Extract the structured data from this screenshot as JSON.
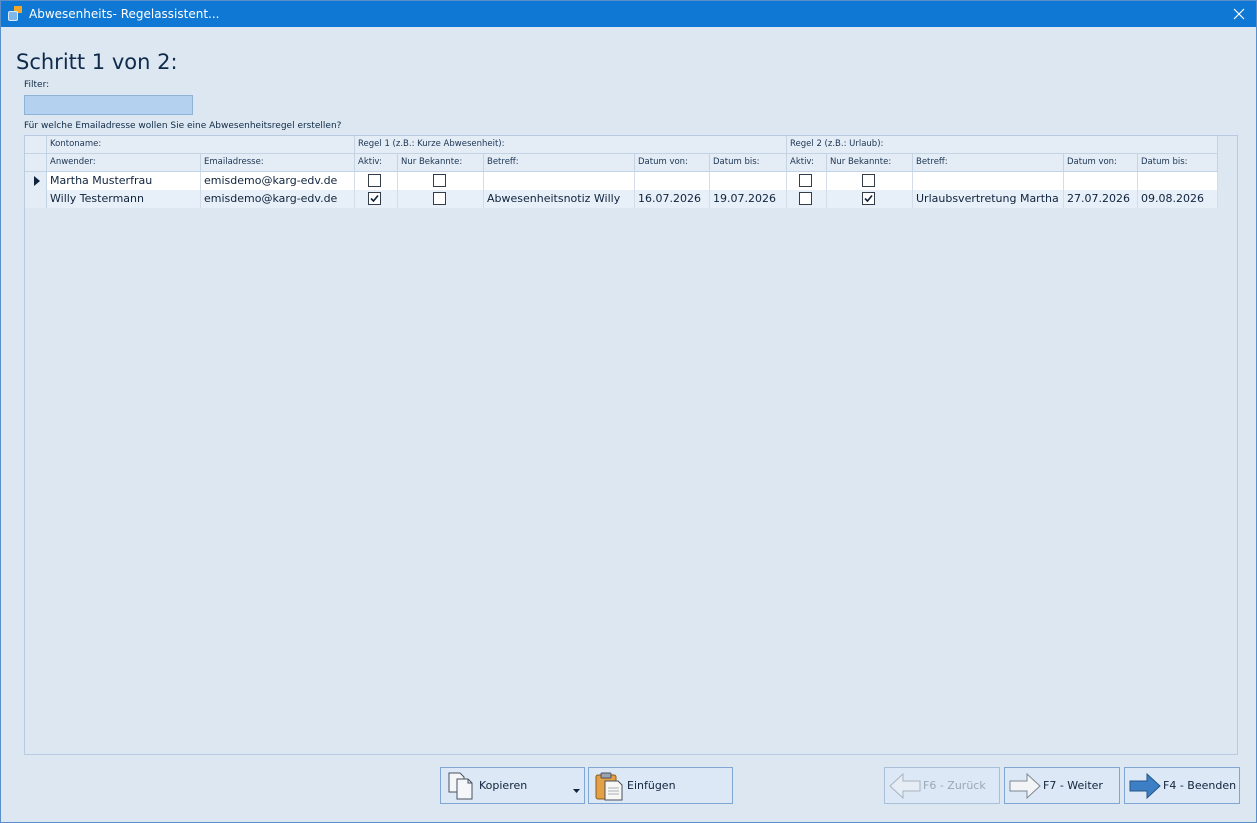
{
  "window": {
    "title": "Abwesenheits- Regelassistent..."
  },
  "step_title": "Schritt 1 von 2:",
  "filter": {
    "label": "Filter:",
    "value": ""
  },
  "question": "Für welche Emailadresse wollen Sie eine Abwesenheitsregel erstellen?",
  "grid": {
    "group_headers": {
      "konto": "Kontoname:",
      "rule1": "Regel 1 (z.B.: Kurze Abwesenheit):",
      "rule2": "Regel 2 (z.B.: Urlaub):"
    },
    "columns": {
      "anwender": "Anwender:",
      "email": "Emailadresse:",
      "r1_aktiv": "Aktiv:",
      "r1_bekannte": "Nur Bekannte:",
      "r1_betreff": "Betreff:",
      "r1_von": "Datum von:",
      "r1_bis": "Datum bis:",
      "r2_aktiv": "Aktiv:",
      "r2_bekannte": "Nur Bekannte:",
      "r2_betreff": "Betreff:",
      "r2_von": "Datum von:",
      "r2_bis": "Datum bis:"
    },
    "rows": [
      {
        "current": true,
        "anwender": "Martha Musterfrau",
        "email": "emisdemo@karg-edv.de",
        "r1_aktiv": false,
        "r1_bekannte": false,
        "r1_betreff": "",
        "r1_von": "",
        "r1_bis": "",
        "r2_aktiv": false,
        "r2_bekannte": false,
        "r2_betreff": "",
        "r2_von": "",
        "r2_bis": ""
      },
      {
        "current": false,
        "anwender": "Willy Testermann",
        "email": "emisdemo@karg-edv.de",
        "r1_aktiv": true,
        "r1_bekannte": false,
        "r1_betreff": "Abwesenheitsnotiz Willy",
        "r1_von": "16.07.2026",
        "r1_bis": "19.07.2026",
        "r2_aktiv": false,
        "r2_bekannte": true,
        "r2_betreff": "Urlaubsvertretung Martha",
        "r2_von": "27.07.2026",
        "r2_bis": "09.08.2026"
      }
    ]
  },
  "buttons": {
    "kopieren": "Kopieren",
    "einfuegen": "Einfügen",
    "zurueck": "F6 - Zurück",
    "weiter": "F7 - Weiter",
    "beenden": "F4 - Beenden"
  },
  "icons": {
    "app": "app-icon",
    "close": "close-icon",
    "copy": "copy-icon",
    "paste": "clipboard-icon",
    "back": "arrow-left-icon",
    "next": "arrow-right-icon",
    "finish": "arrow-right-blue-icon",
    "dropdown": "caret-down-icon"
  },
  "colors": {
    "titlebar": "#0f78d4",
    "window_bg": "#dde7f2",
    "filter_bg": "#b4d2ef",
    "button_border": "#7fa7d2"
  }
}
